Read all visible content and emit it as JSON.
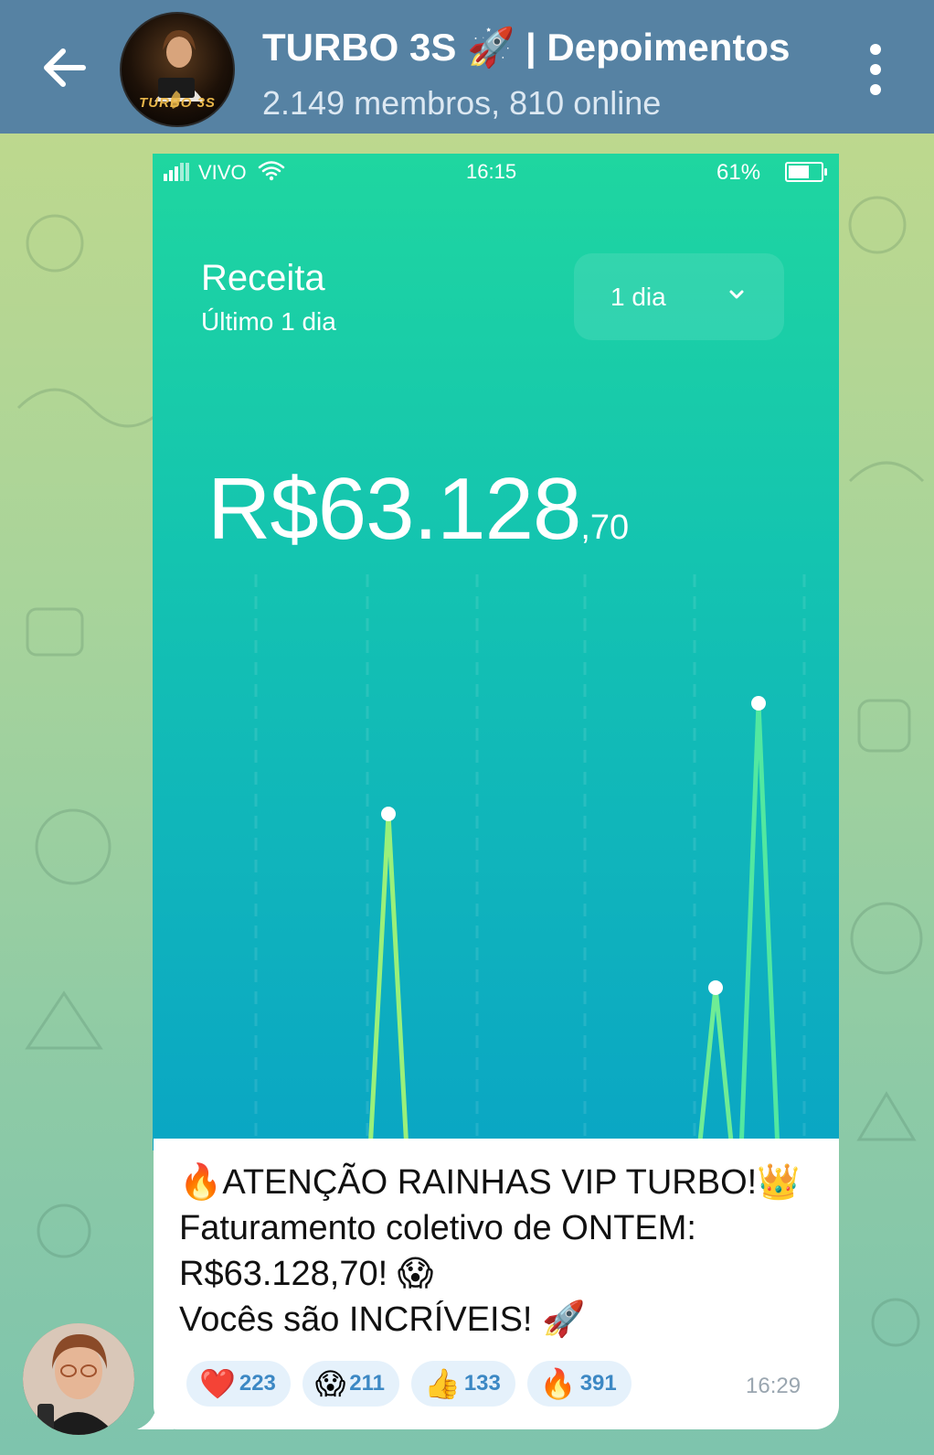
{
  "header": {
    "back_icon": "arrow-left-icon",
    "avatar_brand": "TURBO 3S",
    "title": "TURBO 3S 🚀 | Depoimentos",
    "subtitle": "2.149 membros, 810 online",
    "menu_icon": "more-vertical-icon"
  },
  "screenshot": {
    "status_bar": {
      "carrier": "VIVO",
      "time": "16:15",
      "battery": "61%"
    },
    "title": "Receita",
    "subtitle": "Último 1 dia",
    "period": "1 dia",
    "amount_main": "R$63.128",
    "amount_cents": ",70"
  },
  "message": {
    "lines": [
      "🔥ATENÇÃO RAINHAS VIP TURBO!👑",
      "Faturamento coletivo de ONTEM:",
      "R$63.128,70! 😱",
      "Vocês são INCRÍVEIS! 🚀"
    ],
    "reactions": [
      {
        "emoji": "❤️",
        "count": "223"
      },
      {
        "emoji": "😱",
        "count": "211"
      },
      {
        "emoji": "👍",
        "count": "133"
      },
      {
        "emoji": "🔥",
        "count": "391"
      }
    ],
    "time": "16:29"
  },
  "colors": {
    "header_bg": "#5682a3",
    "chart_line": "#7ef08a",
    "reaction_count": "#3c88c4"
  }
}
